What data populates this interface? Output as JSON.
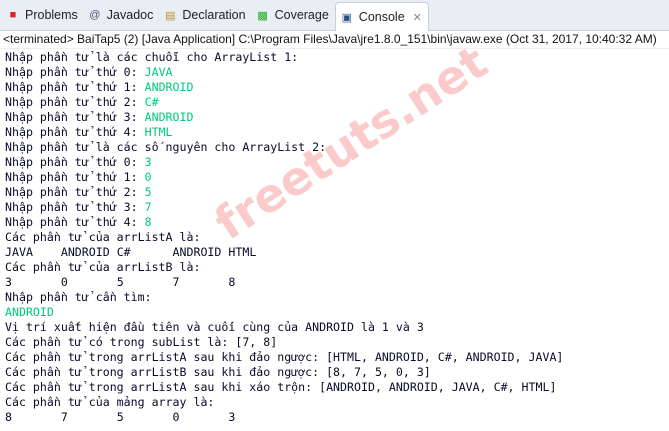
{
  "tabs": [
    {
      "label": "Problems",
      "icon": "problems-icon"
    },
    {
      "label": "Javadoc",
      "icon": "at-icon"
    },
    {
      "label": "Declaration",
      "icon": "declaration-icon"
    },
    {
      "label": "Coverage",
      "icon": "coverage-icon"
    },
    {
      "label": "Console",
      "icon": "console-icon",
      "active": true
    }
  ],
  "status": "<terminated> BaiTap5 (2) [Java Application] C:\\Program Files\\Java\\jre1.8.0_151\\bin\\javaw.exe (Oct 31, 2017, 10:40:32 AM)",
  "colors": {
    "input": "#00c87d",
    "output": "#0a0a2a",
    "tabbar": "#e9eef5"
  },
  "watermark": "freetuts.net",
  "lines": [
    {
      "text": "Nhập phần tử là các chuỗi cho ArrayList 1:"
    },
    {
      "text": "Nhập phần tử thứ 0: ",
      "input": "JAVA"
    },
    {
      "text": "Nhập phần tử thứ 1: ",
      "input": "ANDROID"
    },
    {
      "text": "Nhập phần tử thứ 2: ",
      "input": "C#"
    },
    {
      "text": "Nhập phần tử thứ 3: ",
      "input": "ANDROID"
    },
    {
      "text": "Nhập phần tử thứ 4: ",
      "input": "HTML"
    },
    {
      "text": "Nhập phần tử là các số nguyên cho ArrayList 2:"
    },
    {
      "text": "Nhập phần tử thứ 0: ",
      "input": "3"
    },
    {
      "text": "Nhập phần tử thứ 1: ",
      "input": "0"
    },
    {
      "text": "Nhập phần tử thứ 2: ",
      "input": "5"
    },
    {
      "text": "Nhập phần tử thứ 3: ",
      "input": "7"
    },
    {
      "text": "Nhập phần tử thứ 4: ",
      "input": "8"
    },
    {
      "text": "Các phần tử của arrListA là:"
    },
    {
      "text": "JAVA\tANDROID\tC#\tANDROID\tHTML"
    },
    {
      "text": "Các phần tử của arrListB là:"
    },
    {
      "text": "3\t0\t5\t7\t8"
    },
    {
      "text": "Nhập phần tử cần tìm:"
    },
    {
      "text": "",
      "input": "ANDROID"
    },
    {
      "text": "Vị trí xuất hiện đầu tiên và cuối cùng của ANDROID là 1 và 3"
    },
    {
      "text": "Các phần tử có trong subList là: [7, 8]"
    },
    {
      "text": "Các phần tử trong arrListA sau khi đảo ngược: [HTML, ANDROID, C#, ANDROID, JAVA]"
    },
    {
      "text": "Các phần tử trong arrListB sau khi đảo ngược: [8, 7, 5, 0, 3]"
    },
    {
      "text": "Các phần tử trong arrListA sau khi xáo trộn: [ANDROID, ANDROID, JAVA, C#, HTML]"
    },
    {
      "text": "Các phần tử của mảng array là:"
    },
    {
      "text": "8\t7\t5\t0\t3"
    }
  ]
}
